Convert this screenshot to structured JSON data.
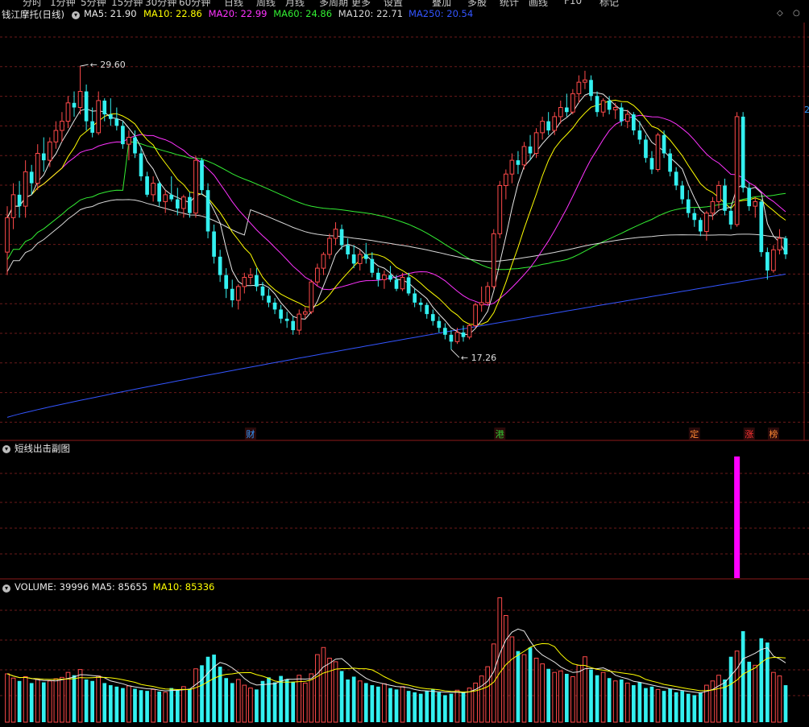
{
  "top_menu": [
    "分时",
    "1分钟",
    "5分钟",
    "15分钟",
    "30分钟",
    "60分钟",
    "日线",
    "周线",
    "月线",
    "多周期",
    "更多",
    "设置",
    "叠加",
    "多股",
    "统计",
    "画线",
    "F10",
    "标记"
  ],
  "main_header": {
    "stock_name": "钱江摩托(日线)",
    "indicators": [
      {
        "label": "MA5: 21.90",
        "color": "#e8e8e8"
      },
      {
        "label": "MA10: 22.86",
        "color": "#ffff00"
      },
      {
        "label": "MA20: 22.99",
        "color": "#ff33ff"
      },
      {
        "label": "MA60: 24.86",
        "color": "#33ee33"
      },
      {
        "label": "MA120: 22.71",
        "color": "#d8d8d8"
      },
      {
        "label": "MA250: 20.54",
        "color": "#3355ff"
      }
    ]
  },
  "sub_header": {
    "title": "短线出击副图"
  },
  "volume_header": {
    "indicators": [
      {
        "label": "VOLUME: 39996",
        "color": "#e8e8e8"
      },
      {
        "label": "MA5: 85655",
        "color": "#e8e8e8"
      },
      {
        "label": "MA10: 85336",
        "color": "#ffff00"
      }
    ]
  },
  "annotations": {
    "high": "29.60",
    "low": "17.26",
    "right_edge_value": "2"
  },
  "event_markers": [
    {
      "label": "财",
      "color": "#3399ff"
    },
    {
      "label": "港",
      "color": "#33cc33"
    },
    {
      "label": "定",
      "color": "#ff8833"
    },
    {
      "label": "涨",
      "color": "#ff3333"
    },
    {
      "label": "榜",
      "color": "#ff8833"
    }
  ],
  "colors": {
    "up": "#ff4a4a",
    "down": "#33f0f0",
    "grid": "#6b1a1a",
    "divider": "#8b1a1a",
    "signal": "#ff00ff"
  },
  "chart_data": {
    "type": "candlestick",
    "title": "钱江摩托(日线)",
    "ylim_price": [
      14.0,
      31.5
    ],
    "ylim_volume": [
      0,
      180000
    ],
    "annotations": {
      "max": 29.6,
      "min": 17.26
    },
    "candles": [
      [
        21.5,
        23.5,
        20.5,
        23.0
      ],
      [
        23.0,
        24.5,
        22.5,
        24.0
      ],
      [
        24.0,
        24.6,
        23.0,
        23.5
      ],
      [
        23.5,
        25.5,
        23.0,
        25.0
      ],
      [
        25.0,
        25.3,
        24.0,
        24.5
      ],
      [
        24.5,
        26.2,
        24.2,
        25.8
      ],
      [
        25.8,
        26.5,
        25.0,
        25.5
      ],
      [
        25.5,
        26.5,
        25.2,
        26.3
      ],
      [
        26.3,
        27.2,
        26.0,
        26.8
      ],
      [
        26.8,
        27.6,
        26.3,
        27.2
      ],
      [
        27.2,
        28.3,
        26.9,
        28.0
      ],
      [
        28.0,
        28.5,
        27.4,
        27.8
      ],
      [
        27.8,
        29.6,
        27.5,
        28.5
      ],
      [
        28.5,
        28.8,
        26.8,
        27.2
      ],
      [
        27.2,
        27.8,
        26.5,
        26.7
      ],
      [
        26.7,
        28.5,
        26.6,
        28.1
      ],
      [
        28.1,
        28.2,
        27.2,
        27.5
      ],
      [
        27.5,
        28.2,
        27.0,
        27.3
      ],
      [
        27.3,
        27.8,
        26.8,
        27.0
      ],
      [
        27.0,
        27.2,
        26.0,
        26.2
      ],
      [
        26.2,
        26.8,
        25.5,
        26.5
      ],
      [
        26.5,
        26.8,
        25.6,
        25.8
      ],
      [
        25.8,
        26.1,
        24.6,
        24.8
      ],
      [
        24.8,
        25.0,
        23.9,
        24.0
      ],
      [
        24.0,
        24.8,
        23.7,
        24.5
      ],
      [
        24.5,
        24.6,
        23.5,
        23.7
      ],
      [
        23.7,
        24.2,
        23.2,
        24.0
      ],
      [
        24.0,
        24.8,
        23.7,
        23.8
      ],
      [
        23.8,
        24.3,
        23.1,
        23.4
      ],
      [
        23.4,
        24.0,
        23.0,
        23.9
      ],
      [
        23.9,
        24.1,
        23.0,
        23.2
      ],
      [
        23.2,
        25.7,
        23.0,
        25.5
      ],
      [
        25.5,
        25.6,
        24.0,
        24.2
      ],
      [
        24.2,
        24.5,
        22.1,
        22.4
      ],
      [
        22.4,
        22.7,
        21.0,
        21.3
      ],
      [
        21.3,
        21.6,
        20.2,
        20.5
      ],
      [
        20.5,
        20.8,
        19.5,
        19.9
      ],
      [
        19.9,
        20.3,
        19.1,
        19.4
      ],
      [
        19.4,
        20.1,
        19.0,
        20.0
      ],
      [
        20.0,
        20.6,
        19.7,
        20.4
      ],
      [
        20.4,
        20.8,
        20.1,
        20.5
      ],
      [
        20.5,
        20.8,
        19.8,
        20.0
      ],
      [
        20.0,
        20.2,
        19.4,
        19.6
      ],
      [
        19.6,
        19.9,
        19.1,
        19.3
      ],
      [
        19.3,
        19.5,
        18.8,
        19.0
      ],
      [
        19.0,
        19.2,
        18.4,
        18.6
      ],
      [
        18.6,
        18.9,
        18.2,
        18.5
      ],
      [
        18.5,
        18.7,
        17.9,
        18.1
      ],
      [
        18.1,
        19.0,
        17.9,
        18.8
      ],
      [
        18.8,
        19.1,
        18.6,
        18.9
      ],
      [
        18.9,
        20.3,
        18.8,
        20.2
      ],
      [
        20.2,
        21.0,
        20.0,
        20.8
      ],
      [
        20.8,
        21.5,
        20.5,
        21.4
      ],
      [
        21.4,
        22.3,
        21.2,
        22.1
      ],
      [
        22.1,
        22.8,
        21.8,
        22.5
      ],
      [
        22.5,
        22.7,
        21.6,
        21.8
      ],
      [
        21.8,
        22.1,
        21.2,
        21.4
      ],
      [
        21.4,
        21.8,
        20.8,
        21.0
      ],
      [
        21.0,
        21.6,
        20.7,
        21.4
      ],
      [
        21.4,
        21.9,
        21.0,
        21.2
      ],
      [
        21.2,
        21.5,
        20.4,
        20.6
      ],
      [
        20.6,
        20.8,
        20.0,
        20.3
      ],
      [
        20.3,
        20.7,
        19.9,
        20.5
      ],
      [
        20.5,
        20.9,
        20.2,
        20.3
      ],
      [
        20.3,
        20.5,
        19.8,
        19.9
      ],
      [
        19.9,
        20.6,
        19.8,
        20.4
      ],
      [
        20.4,
        20.6,
        19.6,
        19.7
      ],
      [
        19.7,
        19.9,
        19.1,
        19.3
      ],
      [
        19.3,
        19.5,
        18.9,
        19.2
      ],
      [
        19.2,
        19.3,
        18.6,
        18.8
      ],
      [
        18.8,
        19.0,
        18.3,
        18.5
      ],
      [
        18.5,
        18.7,
        18.0,
        18.2
      ],
      [
        18.2,
        18.4,
        17.7,
        17.9
      ],
      [
        17.9,
        18.1,
        17.26,
        17.6
      ],
      [
        17.6,
        18.2,
        17.5,
        18.0
      ],
      [
        18.0,
        18.3,
        17.6,
        17.8
      ],
      [
        17.8,
        18.4,
        17.7,
        18.3
      ],
      [
        18.3,
        19.3,
        18.2,
        19.2
      ],
      [
        19.2,
        20.0,
        18.9,
        19.3
      ],
      [
        19.3,
        20.2,
        19.2,
        20.0
      ],
      [
        20.0,
        22.5,
        19.9,
        22.3
      ],
      [
        22.3,
        24.6,
        22.1,
        24.4
      ],
      [
        24.4,
        25.1,
        23.8,
        24.9
      ],
      [
        24.9,
        25.8,
        24.5,
        25.5
      ],
      [
        25.5,
        25.9,
        24.9,
        25.3
      ],
      [
        25.3,
        26.3,
        25.1,
        26.1
      ],
      [
        26.1,
        26.6,
        25.5,
        25.8
      ],
      [
        25.8,
        26.9,
        25.6,
        26.7
      ],
      [
        26.7,
        27.4,
        26.4,
        27.2
      ],
      [
        27.2,
        27.6,
        26.6,
        26.8
      ],
      [
        26.8,
        27.6,
        26.6,
        27.4
      ],
      [
        27.4,
        28.1,
        27.1,
        27.8
      ],
      [
        27.8,
        28.4,
        27.4,
        27.6
      ],
      [
        27.6,
        28.6,
        27.5,
        28.4
      ],
      [
        28.4,
        29.2,
        28.0,
        28.9
      ],
      [
        28.9,
        29.4,
        28.6,
        29.0
      ],
      [
        29.0,
        29.2,
        28.1,
        28.3
      ],
      [
        28.3,
        28.5,
        27.4,
        27.6
      ],
      [
        27.6,
        28.2,
        27.4,
        28.1
      ],
      [
        28.1,
        28.3,
        27.5,
        27.7
      ],
      [
        27.7,
        28.0,
        27.3,
        27.8
      ],
      [
        27.8,
        28.0,
        27.0,
        27.2
      ],
      [
        27.2,
        27.7,
        26.9,
        27.5
      ],
      [
        27.5,
        27.6,
        26.6,
        26.8
      ],
      [
        26.8,
        27.2,
        26.2,
        26.4
      ],
      [
        26.4,
        26.6,
        25.4,
        25.6
      ],
      [
        25.6,
        25.9,
        24.9,
        25.1
      ],
      [
        25.1,
        26.7,
        25.0,
        26.6
      ],
      [
        26.6,
        26.8,
        25.6,
        25.8
      ],
      [
        25.8,
        26.0,
        24.8,
        25.0
      ],
      [
        25.0,
        25.2,
        24.2,
        24.4
      ],
      [
        24.4,
        24.6,
        23.6,
        23.8
      ],
      [
        23.8,
        24.2,
        23.0,
        23.2
      ],
      [
        23.2,
        23.4,
        22.6,
        22.9
      ],
      [
        22.9,
        23.0,
        22.2,
        22.4
      ],
      [
        22.4,
        23.3,
        22.0,
        23.2
      ],
      [
        23.2,
        23.9,
        22.9,
        23.7
      ],
      [
        23.7,
        24.6,
        23.4,
        24.4
      ],
      [
        24.4,
        24.7,
        23.1,
        23.3
      ],
      [
        23.3,
        23.5,
        22.5,
        22.7
      ],
      [
        22.7,
        27.6,
        22.6,
        27.4
      ],
      [
        27.4,
        27.6,
        24.1,
        24.3
      ],
      [
        24.3,
        24.5,
        23.3,
        23.5
      ],
      [
        23.5,
        23.9,
        23.0,
        23.7
      ],
      [
        23.7,
        23.8,
        21.3,
        21.5
      ],
      [
        21.5,
        21.7,
        20.3,
        20.7
      ],
      [
        20.7,
        21.8,
        20.6,
        21.6
      ],
      [
        21.6,
        22.5,
        21.4,
        22.1
      ],
      [
        22.1,
        22.2,
        21.2,
        21.4
      ]
    ],
    "volume": [
      68000,
      62000,
      58000,
      64000,
      55000,
      60000,
      56000,
      58000,
      61000,
      63000,
      70000,
      66000,
      74000,
      60000,
      58000,
      65000,
      55000,
      52000,
      50000,
      48000,
      51000,
      47000,
      45000,
      44000,
      46000,
      43000,
      42000,
      48000,
      45000,
      50000,
      47000,
      75000,
      80000,
      92000,
      95000,
      78000,
      62000,
      55000,
      60000,
      52000,
      48000,
      46000,
      58000,
      63000,
      56000,
      65000,
      60000,
      57000,
      66000,
      55000,
      68000,
      95000,
      105000,
      90000,
      85000,
      72000,
      60000,
      64000,
      58000,
      55000,
      52000,
      50000,
      54000,
      48000,
      46000,
      50000,
      44000,
      42000,
      40000,
      44000,
      46000,
      42000,
      38000,
      40000,
      45000,
      42000,
      48000,
      55000,
      65000,
      78000,
      110000,
      175000,
      150000,
      120000,
      100000,
      95000,
      105000,
      90000,
      82000,
      75000,
      70000,
      72000,
      68000,
      64000,
      80000,
      92000,
      74000,
      66000,
      70000,
      62000,
      58000,
      60000,
      55000,
      52000,
      56000,
      48000,
      50000,
      46000,
      44000,
      47000,
      42000,
      44000,
      40000,
      38000,
      42000,
      52000,
      58000,
      66000,
      60000,
      92000,
      100000,
      128000,
      85000,
      80000,
      118000,
      112000,
      70000,
      65000,
      52000
    ],
    "signal": [
      0,
      0,
      0,
      0,
      0,
      0,
      0,
      0,
      0,
      0,
      0,
      0,
      0,
      0,
      0,
      0,
      0,
      0,
      0,
      0,
      0,
      0,
      0,
      0,
      0,
      0,
      0,
      0,
      0,
      0,
      0,
      0,
      0,
      0,
      0,
      0,
      0,
      0,
      0,
      0,
      0,
      0,
      0,
      0,
      0,
      0,
      0,
      0,
      0,
      0,
      0,
      0,
      0,
      0,
      0,
      0,
      0,
      0,
      0,
      0,
      0,
      0,
      0,
      0,
      0,
      0,
      0,
      0,
      0,
      0,
      0,
      0,
      0,
      0,
      0,
      0,
      0,
      0,
      0,
      0,
      0,
      0,
      0,
      0,
      0,
      0,
      0,
      0,
      0,
      0,
      0,
      0,
      0,
      0,
      0,
      0,
      0,
      0,
      0,
      0,
      0,
      0,
      0,
      0,
      0,
      0,
      0,
      0,
      0,
      0,
      0,
      0,
      0,
      0,
      0,
      0,
      0,
      0,
      0,
      0,
      1,
      0,
      0,
      0,
      0,
      0,
      0,
      0,
      0
    ],
    "event_marker_index": [
      40,
      81,
      113,
      122,
      126
    ],
    "ma_ending_values": {
      "MA5": 21.9,
      "MA10": 22.86,
      "MA20": 22.99,
      "MA60": 24.86,
      "MA120": 22.71,
      "MA250": 20.54
    },
    "volume_ma_ending_values": {
      "MA5": 85655,
      "MA10": 85336
    }
  }
}
